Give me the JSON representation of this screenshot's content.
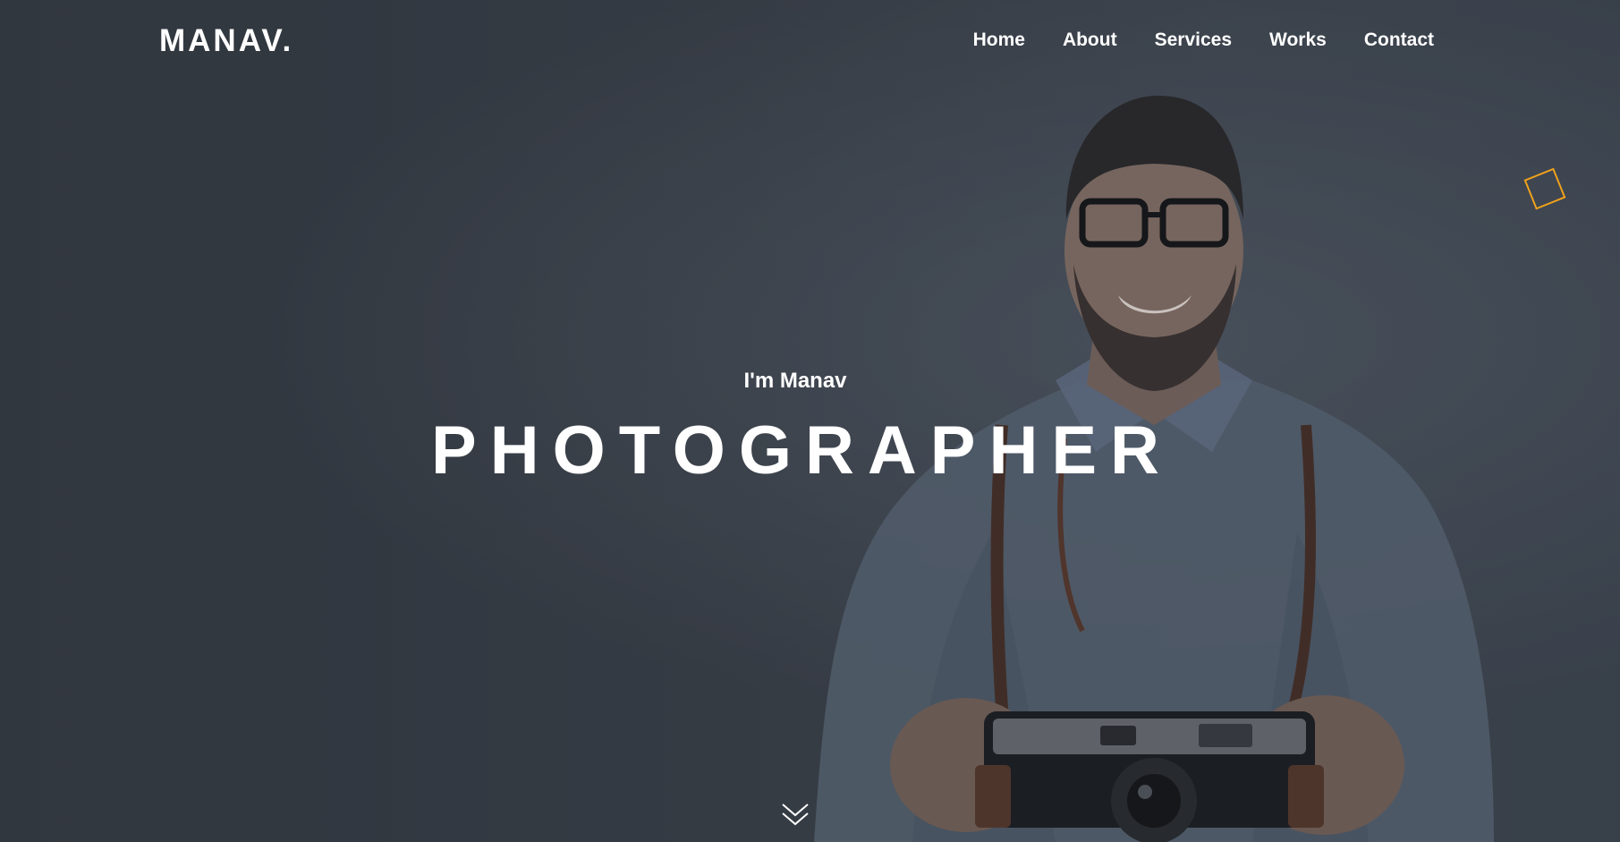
{
  "header": {
    "brand": "MANAV.",
    "nav": [
      "Home",
      "About",
      "Services",
      "Works",
      "Contact"
    ]
  },
  "hero": {
    "intro": "I'm Manav",
    "headline": "PHOTOGRAPHER",
    "scroll_icon": "chevron-double-down-icon",
    "decoration_icon": "outlined-square-icon"
  },
  "colors": {
    "background": "#3b4148",
    "text": "#ffffff",
    "accent": "#f0a21b"
  }
}
